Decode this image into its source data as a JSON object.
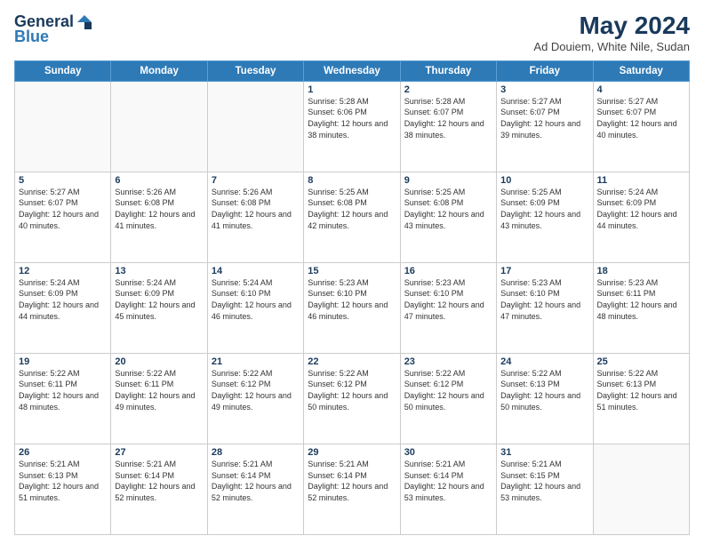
{
  "header": {
    "logo_general": "General",
    "logo_blue": "Blue",
    "month_title": "May 2024",
    "subtitle": "Ad Douiem, White Nile, Sudan"
  },
  "days_of_week": [
    "Sunday",
    "Monday",
    "Tuesday",
    "Wednesday",
    "Thursday",
    "Friday",
    "Saturday"
  ],
  "weeks": [
    [
      {
        "day": "",
        "sunrise": "",
        "sunset": "",
        "daylight": ""
      },
      {
        "day": "",
        "sunrise": "",
        "sunset": "",
        "daylight": ""
      },
      {
        "day": "",
        "sunrise": "",
        "sunset": "",
        "daylight": ""
      },
      {
        "day": "1",
        "sunrise": "Sunrise: 5:28 AM",
        "sunset": "Sunset: 6:06 PM",
        "daylight": "Daylight: 12 hours and 38 minutes."
      },
      {
        "day": "2",
        "sunrise": "Sunrise: 5:28 AM",
        "sunset": "Sunset: 6:07 PM",
        "daylight": "Daylight: 12 hours and 38 minutes."
      },
      {
        "day": "3",
        "sunrise": "Sunrise: 5:27 AM",
        "sunset": "Sunset: 6:07 PM",
        "daylight": "Daylight: 12 hours and 39 minutes."
      },
      {
        "day": "4",
        "sunrise": "Sunrise: 5:27 AM",
        "sunset": "Sunset: 6:07 PM",
        "daylight": "Daylight: 12 hours and 40 minutes."
      }
    ],
    [
      {
        "day": "5",
        "sunrise": "Sunrise: 5:27 AM",
        "sunset": "Sunset: 6:07 PM",
        "daylight": "Daylight: 12 hours and 40 minutes."
      },
      {
        "day": "6",
        "sunrise": "Sunrise: 5:26 AM",
        "sunset": "Sunset: 6:08 PM",
        "daylight": "Daylight: 12 hours and 41 minutes."
      },
      {
        "day": "7",
        "sunrise": "Sunrise: 5:26 AM",
        "sunset": "Sunset: 6:08 PM",
        "daylight": "Daylight: 12 hours and 41 minutes."
      },
      {
        "day": "8",
        "sunrise": "Sunrise: 5:25 AM",
        "sunset": "Sunset: 6:08 PM",
        "daylight": "Daylight: 12 hours and 42 minutes."
      },
      {
        "day": "9",
        "sunrise": "Sunrise: 5:25 AM",
        "sunset": "Sunset: 6:08 PM",
        "daylight": "Daylight: 12 hours and 43 minutes."
      },
      {
        "day": "10",
        "sunrise": "Sunrise: 5:25 AM",
        "sunset": "Sunset: 6:09 PM",
        "daylight": "Daylight: 12 hours and 43 minutes."
      },
      {
        "day": "11",
        "sunrise": "Sunrise: 5:24 AM",
        "sunset": "Sunset: 6:09 PM",
        "daylight": "Daylight: 12 hours and 44 minutes."
      }
    ],
    [
      {
        "day": "12",
        "sunrise": "Sunrise: 5:24 AM",
        "sunset": "Sunset: 6:09 PM",
        "daylight": "Daylight: 12 hours and 44 minutes."
      },
      {
        "day": "13",
        "sunrise": "Sunrise: 5:24 AM",
        "sunset": "Sunset: 6:09 PM",
        "daylight": "Daylight: 12 hours and 45 minutes."
      },
      {
        "day": "14",
        "sunrise": "Sunrise: 5:24 AM",
        "sunset": "Sunset: 6:10 PM",
        "daylight": "Daylight: 12 hours and 46 minutes."
      },
      {
        "day": "15",
        "sunrise": "Sunrise: 5:23 AM",
        "sunset": "Sunset: 6:10 PM",
        "daylight": "Daylight: 12 hours and 46 minutes."
      },
      {
        "day": "16",
        "sunrise": "Sunrise: 5:23 AM",
        "sunset": "Sunset: 6:10 PM",
        "daylight": "Daylight: 12 hours and 47 minutes."
      },
      {
        "day": "17",
        "sunrise": "Sunrise: 5:23 AM",
        "sunset": "Sunset: 6:10 PM",
        "daylight": "Daylight: 12 hours and 47 minutes."
      },
      {
        "day": "18",
        "sunrise": "Sunrise: 5:23 AM",
        "sunset": "Sunset: 6:11 PM",
        "daylight": "Daylight: 12 hours and 48 minutes."
      }
    ],
    [
      {
        "day": "19",
        "sunrise": "Sunrise: 5:22 AM",
        "sunset": "Sunset: 6:11 PM",
        "daylight": "Daylight: 12 hours and 48 minutes."
      },
      {
        "day": "20",
        "sunrise": "Sunrise: 5:22 AM",
        "sunset": "Sunset: 6:11 PM",
        "daylight": "Daylight: 12 hours and 49 minutes."
      },
      {
        "day": "21",
        "sunrise": "Sunrise: 5:22 AM",
        "sunset": "Sunset: 6:12 PM",
        "daylight": "Daylight: 12 hours and 49 minutes."
      },
      {
        "day": "22",
        "sunrise": "Sunrise: 5:22 AM",
        "sunset": "Sunset: 6:12 PM",
        "daylight": "Daylight: 12 hours and 50 minutes."
      },
      {
        "day": "23",
        "sunrise": "Sunrise: 5:22 AM",
        "sunset": "Sunset: 6:12 PM",
        "daylight": "Daylight: 12 hours and 50 minutes."
      },
      {
        "day": "24",
        "sunrise": "Sunrise: 5:22 AM",
        "sunset": "Sunset: 6:13 PM",
        "daylight": "Daylight: 12 hours and 50 minutes."
      },
      {
        "day": "25",
        "sunrise": "Sunrise: 5:22 AM",
        "sunset": "Sunset: 6:13 PM",
        "daylight": "Daylight: 12 hours and 51 minutes."
      }
    ],
    [
      {
        "day": "26",
        "sunrise": "Sunrise: 5:21 AM",
        "sunset": "Sunset: 6:13 PM",
        "daylight": "Daylight: 12 hours and 51 minutes."
      },
      {
        "day": "27",
        "sunrise": "Sunrise: 5:21 AM",
        "sunset": "Sunset: 6:14 PM",
        "daylight": "Daylight: 12 hours and 52 minutes."
      },
      {
        "day": "28",
        "sunrise": "Sunrise: 5:21 AM",
        "sunset": "Sunset: 6:14 PM",
        "daylight": "Daylight: 12 hours and 52 minutes."
      },
      {
        "day": "29",
        "sunrise": "Sunrise: 5:21 AM",
        "sunset": "Sunset: 6:14 PM",
        "daylight": "Daylight: 12 hours and 52 minutes."
      },
      {
        "day": "30",
        "sunrise": "Sunrise: 5:21 AM",
        "sunset": "Sunset: 6:14 PM",
        "daylight": "Daylight: 12 hours and 53 minutes."
      },
      {
        "day": "31",
        "sunrise": "Sunrise: 5:21 AM",
        "sunset": "Sunset: 6:15 PM",
        "daylight": "Daylight: 12 hours and 53 minutes."
      },
      {
        "day": "",
        "sunrise": "",
        "sunset": "",
        "daylight": ""
      }
    ]
  ]
}
